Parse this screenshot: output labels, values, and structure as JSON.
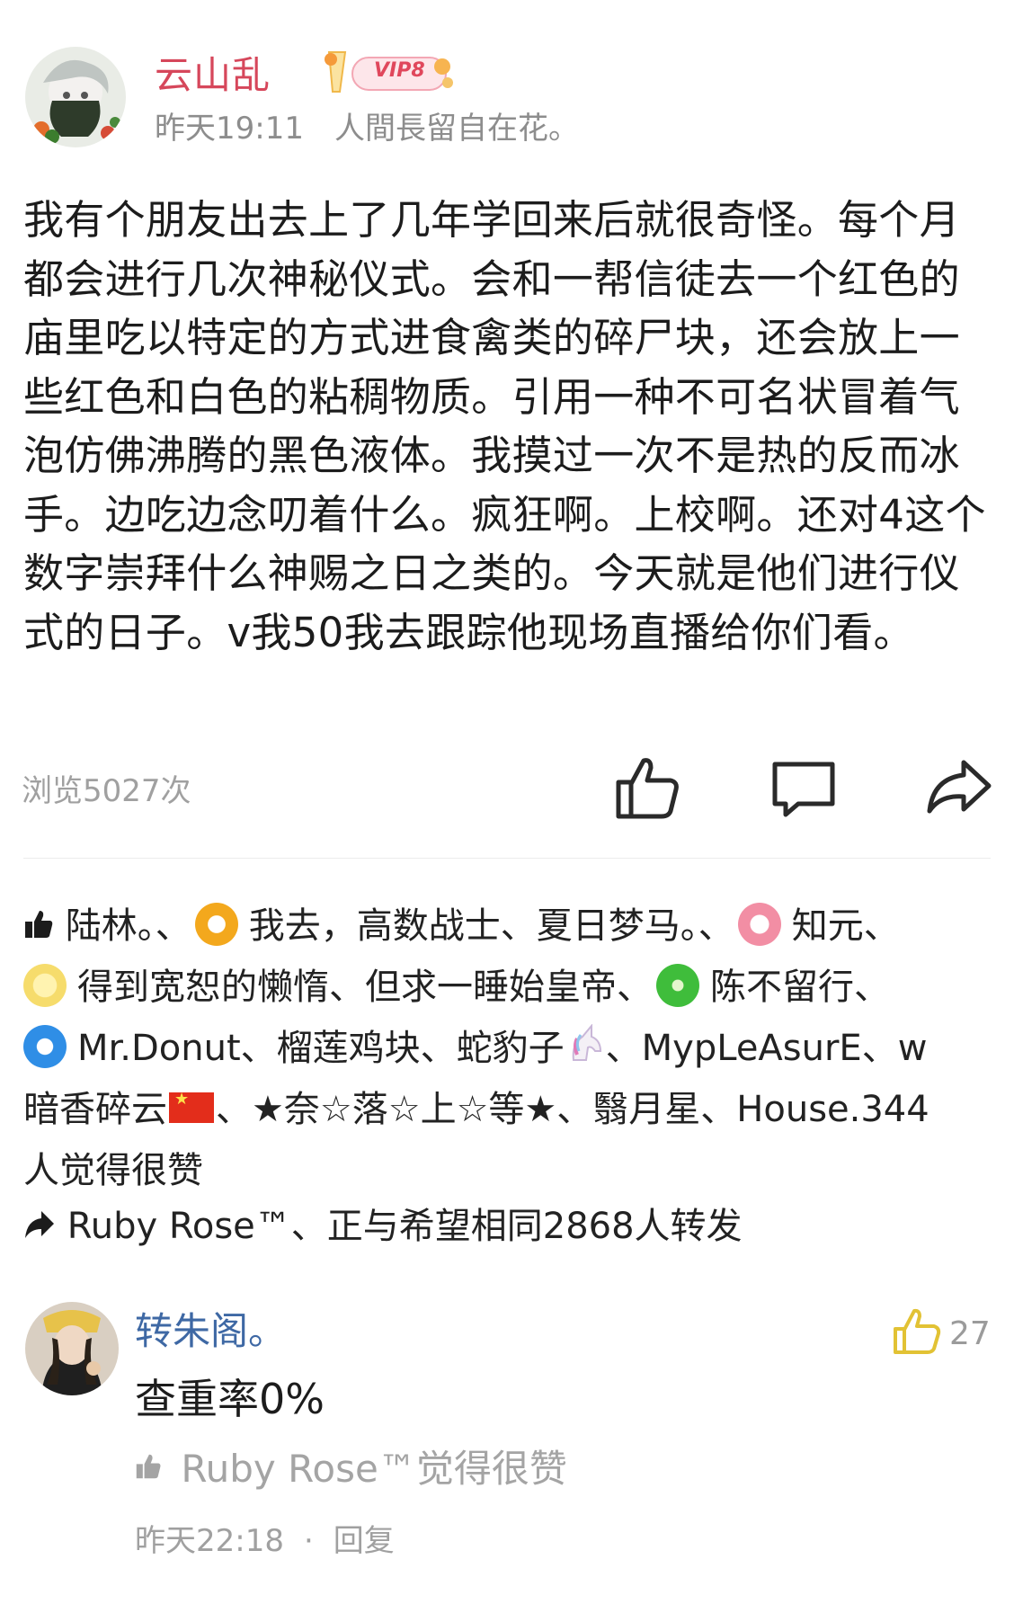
{
  "post": {
    "username": "云山乱",
    "vip_label": "VIP8",
    "time": "昨天19:11",
    "signature": "人間長留自在花。",
    "body": "我有个朋友出去上了几年学回来后就很奇怪。每个月都会进行几次神秘仪式。会和一帮信徒去一个红色的庙里吃以特定的方式进食禽类的碎尸块，还会放上一些红色和白色的粘稠物质。引用一种不可名状冒着气泡仿佛沸腾的黑色液体。我摸过一次不是热的反而冰手。边吃边念叨着什么。疯狂啊。上校啊。还对4这个数字崇拜什么神赐之日之类的。今天就是他们进行仪式的日子。v我50我去跟踪他现场直播给你们看。",
    "views": "浏览5027次"
  },
  "likes": {
    "name_1": "陆林。、",
    "name_2": "我去，高数战士、夏日梦马。、",
    "name_3": "知元、",
    "name_4": "得到宽恕的懒惰、但求一睡始皇帝、",
    "name_5": "陈不留行、",
    "name_6": "Mr.Donut、榴莲鸡块、蛇豹子",
    "name_7": "、MypLeAsurE、w",
    "name_8": "暗香碎云",
    "name_9": "、★奈☆落☆上☆等★、翳月星、House.344",
    "summary": "人觉得很赞"
  },
  "reposts": {
    "text": "Ruby Rose™、正与希望相同2868人转发"
  },
  "comment": {
    "author": "转朱阁。",
    "text": "查重率0%",
    "like_count": "27",
    "liked_by": "Ruby Rose™觉得很赞",
    "time": "昨天22:18",
    "separator": "·",
    "reply_label": "回复"
  },
  "colors": {
    "username": "#d6475b",
    "comment_author": "#3e68a4",
    "comment_like_icon": "#e8c93a",
    "meta_gray": "#8d8d8d"
  },
  "icons": {
    "like": "thumbs-up-icon",
    "comment": "comment-bubble-icon",
    "share": "share-arrow-icon"
  }
}
